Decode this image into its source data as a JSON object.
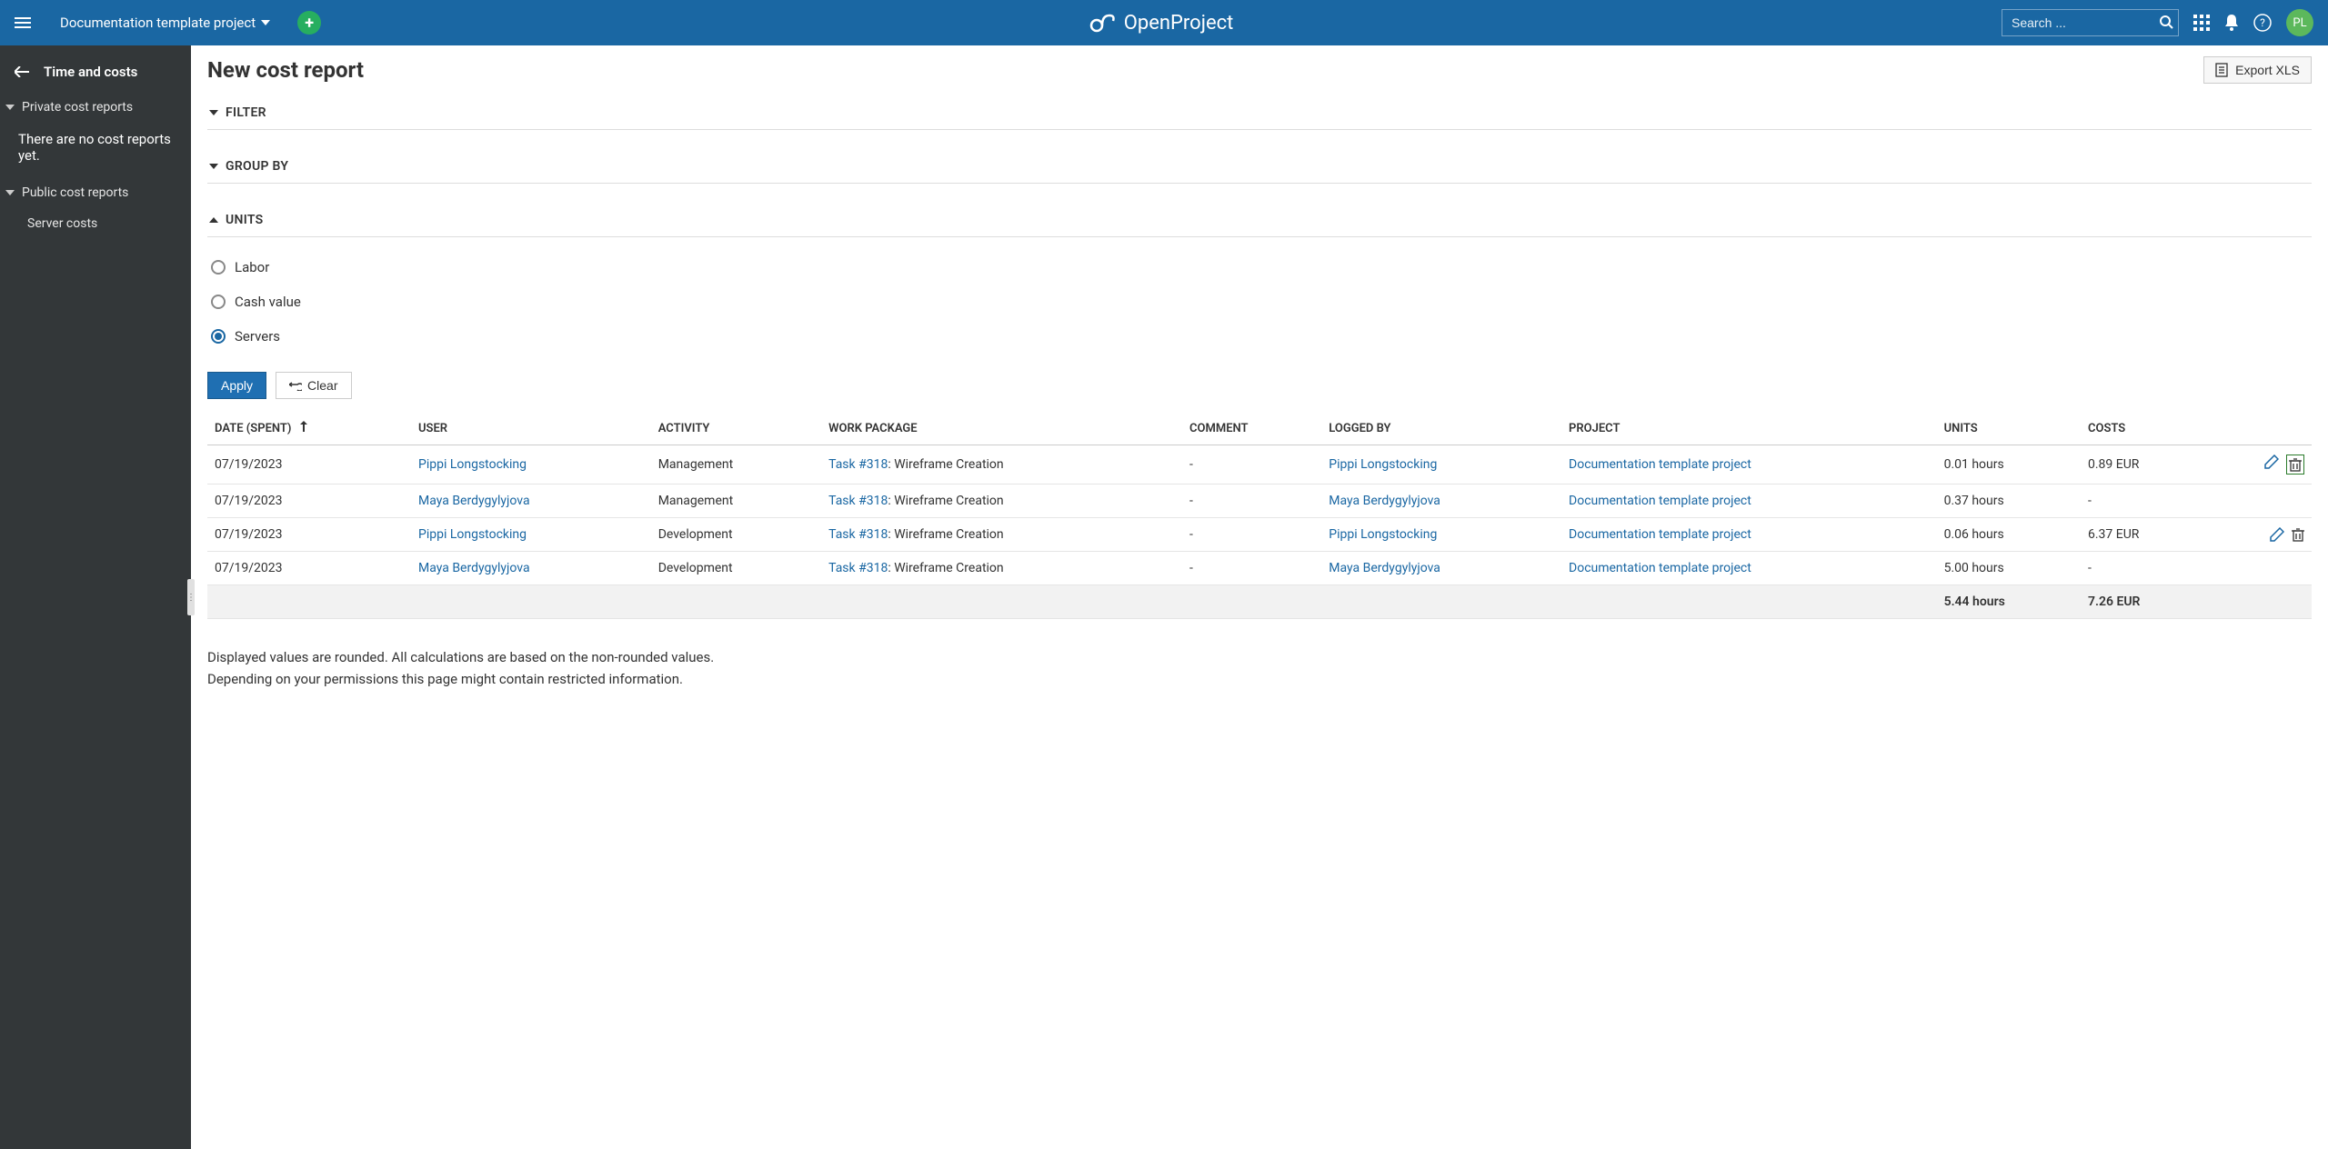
{
  "header": {
    "project_name": "Documentation template project",
    "search_placeholder": "Search ...",
    "logo_text": "OpenProject",
    "avatar_initials": "PL"
  },
  "sidebar": {
    "title": "Time and costs",
    "private_section": "Private cost reports",
    "private_empty": "There are no cost reports yet.",
    "public_section": "Public cost reports",
    "public_items": [
      "Server costs"
    ]
  },
  "page": {
    "title": "New cost report",
    "export_label": "Export XLS",
    "filter_label": "FILTER",
    "group_by_label": "GROUP BY",
    "units_label": "UNITS",
    "unit_options": {
      "labor": "Labor",
      "cash": "Cash value",
      "servers": "Servers"
    },
    "apply_label": "Apply",
    "clear_label": "Clear"
  },
  "table": {
    "columns": {
      "date": "DATE (SPENT)",
      "user": "USER",
      "activity": "ACTIVITY",
      "wp": "WORK PACKAGE",
      "comment": "COMMENT",
      "logged_by": "LOGGED BY",
      "project": "PROJECT",
      "units": "UNITS",
      "costs": "COSTS"
    },
    "rows": [
      {
        "date": "07/19/2023",
        "user": "Pippi Longstocking",
        "activity": "Management",
        "task": "Task #318",
        "task_suffix": ": Wireframe Creation",
        "comment": "-",
        "logged_by": "Pippi Longstocking",
        "project": "Documentation template project",
        "units": "0.01 hours",
        "costs": "0.89 EUR",
        "actions": "both",
        "highlight_delete": true
      },
      {
        "date": "07/19/2023",
        "user": "Maya Berdygylyjova",
        "activity": "Management",
        "task": "Task #318",
        "task_suffix": ": Wireframe Creation",
        "comment": "-",
        "logged_by": "Maya Berdygylyjova",
        "project": "Documentation template project",
        "units": "0.37 hours",
        "costs": "-",
        "actions": "none"
      },
      {
        "date": "07/19/2023",
        "user": "Pippi Longstocking",
        "activity": "Development",
        "task": "Task #318",
        "task_suffix": ": Wireframe Creation",
        "comment": "-",
        "logged_by": "Pippi Longstocking",
        "project": "Documentation template project",
        "units": "0.06 hours",
        "costs": "6.37 EUR",
        "actions": "both"
      },
      {
        "date": "07/19/2023",
        "user": "Maya Berdygylyjova",
        "activity": "Development",
        "task": "Task #318",
        "task_suffix": ": Wireframe Creation",
        "comment": "-",
        "logged_by": "Maya Berdygylyjova",
        "project": "Documentation template project",
        "units": "5.00 hours",
        "costs": "-",
        "actions": "none"
      }
    ],
    "totals": {
      "units": "5.44 hours",
      "costs": "7.26 EUR"
    }
  },
  "footnote": {
    "line1": "Displayed values are rounded. All calculations are based on the non-rounded values.",
    "line2": "Depending on your permissions this page might contain restricted information."
  }
}
